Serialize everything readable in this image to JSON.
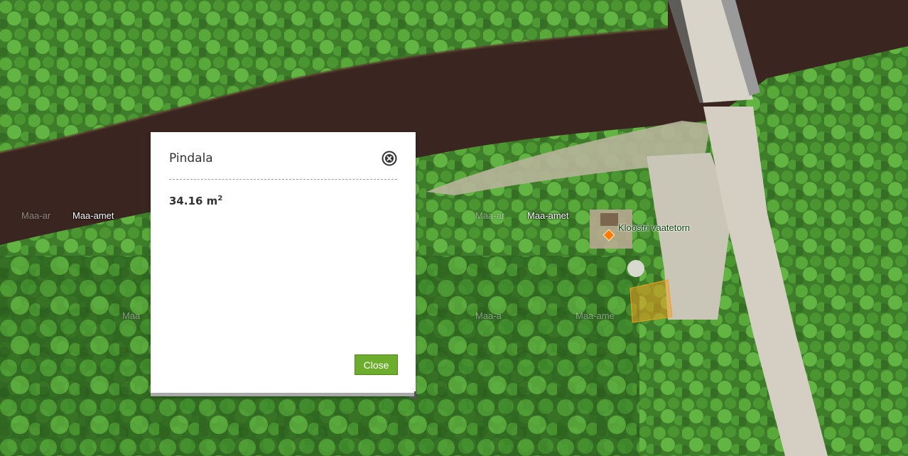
{
  "map": {
    "layer_labels": [
      {
        "id": "l1",
        "text": "Maa-ar",
        "faded": true
      },
      {
        "id": "l2",
        "text": "Maa-amet",
        "faded": false
      },
      {
        "id": "l3",
        "text": "Maa-ar",
        "faded": true
      },
      {
        "id": "l4",
        "text": "Maa-amet",
        "faded": false
      },
      {
        "id": "l5",
        "text": "Maa",
        "faded": true
      },
      {
        "id": "l6",
        "text": "Maa-a",
        "faded": true
      },
      {
        "id": "l7",
        "text": "Maa-ame",
        "faded": true
      }
    ],
    "poi": {
      "label": "Kloostri vaatetorn",
      "marker_color": "#ff7a00"
    },
    "measured_area_color": "#f0a020"
  },
  "popup": {
    "title": "Pindala",
    "value": "34.16 m",
    "value_superscript": "2",
    "close_label": "Close",
    "close_icon": "close-circle-icon"
  },
  "colors": {
    "button_green": "#6cad2e",
    "river": "#3a2520"
  }
}
